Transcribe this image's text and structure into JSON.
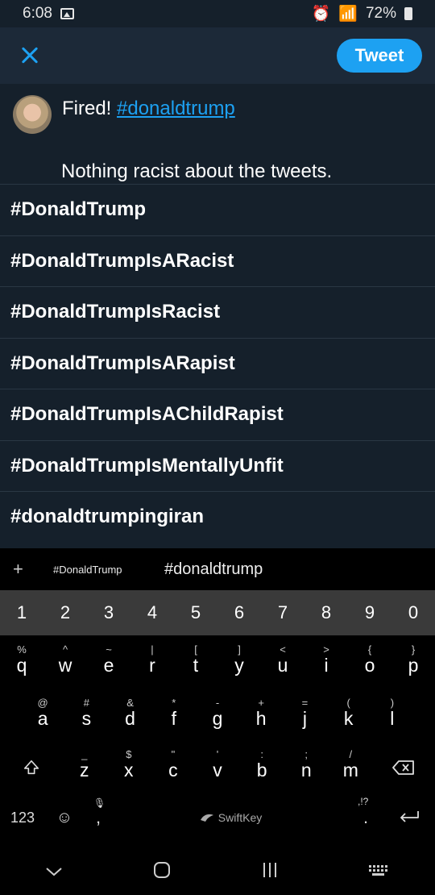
{
  "status": {
    "time": "6:08",
    "battery": "72%"
  },
  "header": {
    "tweet_label": "Tweet"
  },
  "compose": {
    "line1_text": "Fired! ",
    "line1_hashtag": "#donaldtrump",
    "line2_text": "Nothing racist about the tweets."
  },
  "suggestions": [
    "#DonaldTrump",
    "#DonaldTrumpIsARacist",
    "#DonaldTrumpIsRacist",
    "#DonaldTrumpIsARapist",
    "#DonaldTrumpIsAChildRapist",
    "#DonaldTrumpIsMentallyUnfit",
    "#donaldtrumpingiran"
  ],
  "keyboard": {
    "plus": "+",
    "suggestion_1": "#DonaldTrump",
    "suggestion_2": "#donaldtrump",
    "numbers": [
      "1",
      "2",
      "3",
      "4",
      "5",
      "6",
      "7",
      "8",
      "9",
      "0"
    ],
    "row1": [
      {
        "alt": "%",
        "main": "q"
      },
      {
        "alt": "^",
        "main": "w"
      },
      {
        "alt": "~",
        "main": "e"
      },
      {
        "alt": "|",
        "main": "r"
      },
      {
        "alt": "[",
        "main": "t"
      },
      {
        "alt": "]",
        "main": "y"
      },
      {
        "alt": "<",
        "main": "u"
      },
      {
        "alt": ">",
        "main": "i"
      },
      {
        "alt": "{",
        "main": "o"
      },
      {
        "alt": "}",
        "main": "p"
      }
    ],
    "row2": [
      {
        "alt": "@",
        "main": "a"
      },
      {
        "alt": "#",
        "main": "s"
      },
      {
        "alt": "&",
        "main": "d"
      },
      {
        "alt": "*",
        "main": "f"
      },
      {
        "alt": "-",
        "main": "g"
      },
      {
        "alt": "+",
        "main": "h"
      },
      {
        "alt": "=",
        "main": "j"
      },
      {
        "alt": "(",
        "main": "k"
      },
      {
        "alt": ")",
        "main": "l"
      }
    ],
    "row3": [
      {
        "alt": "_",
        "main": "z"
      },
      {
        "alt": "$",
        "main": "x"
      },
      {
        "alt": "\"",
        "main": "c"
      },
      {
        "alt": "'",
        "main": "v"
      },
      {
        "alt": ":",
        "main": "b"
      },
      {
        "alt": ";",
        "main": "n"
      },
      {
        "alt": "/",
        "main": "m"
      }
    ],
    "key_123": "123",
    "comma": ",",
    "space_brand": "SwiftKey",
    "period_alt": ",!?",
    "period": "."
  }
}
